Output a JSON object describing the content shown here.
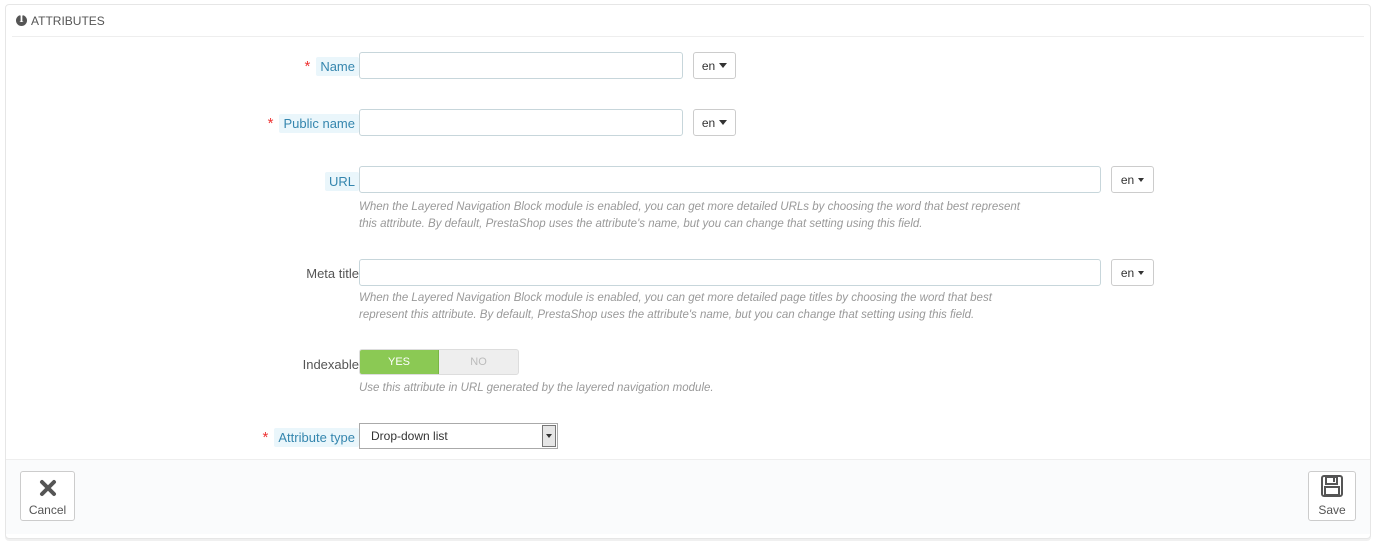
{
  "panel": {
    "title": "ATTRIBUTES",
    "icon": "info-icon"
  },
  "fields": {
    "name": {
      "label": "Name",
      "required": "*",
      "value": "",
      "lang": "en"
    },
    "public_name": {
      "label": "Public name",
      "required": "*",
      "value": "",
      "lang": "en"
    },
    "url": {
      "label": "URL",
      "value": "",
      "lang": "en",
      "help_line1": "When the Layered Navigation Block module is enabled, you can get more detailed URLs by choosing the word that best represent",
      "help_line2": "this attribute. By default, PrestaShop uses the attribute's name, but you can change that setting using this field."
    },
    "meta_title": {
      "label": "Meta title",
      "value": "",
      "lang": "en",
      "help_line1": "When the Layered Navigation Block module is enabled, you can get more detailed page titles by choosing the word that best",
      "help_line2": "represent this attribute. By default, PrestaShop uses the attribute's name, but you can change that setting using this field."
    },
    "indexable": {
      "label": "Indexable",
      "yes": "YES",
      "no": "NO",
      "selected": "YES",
      "help": "Use this attribute in URL generated by the layered navigation module."
    },
    "attribute_type": {
      "label": "Attribute type",
      "required": "*",
      "selected": "Drop-down list"
    }
  },
  "footer": {
    "cancel_label": "Cancel",
    "save_label": "Save"
  },
  "colors": {
    "accent": "#8bc954",
    "required": "#e33333",
    "hint_bg": "#eaf6fb",
    "hint_text": "#3586ae"
  }
}
